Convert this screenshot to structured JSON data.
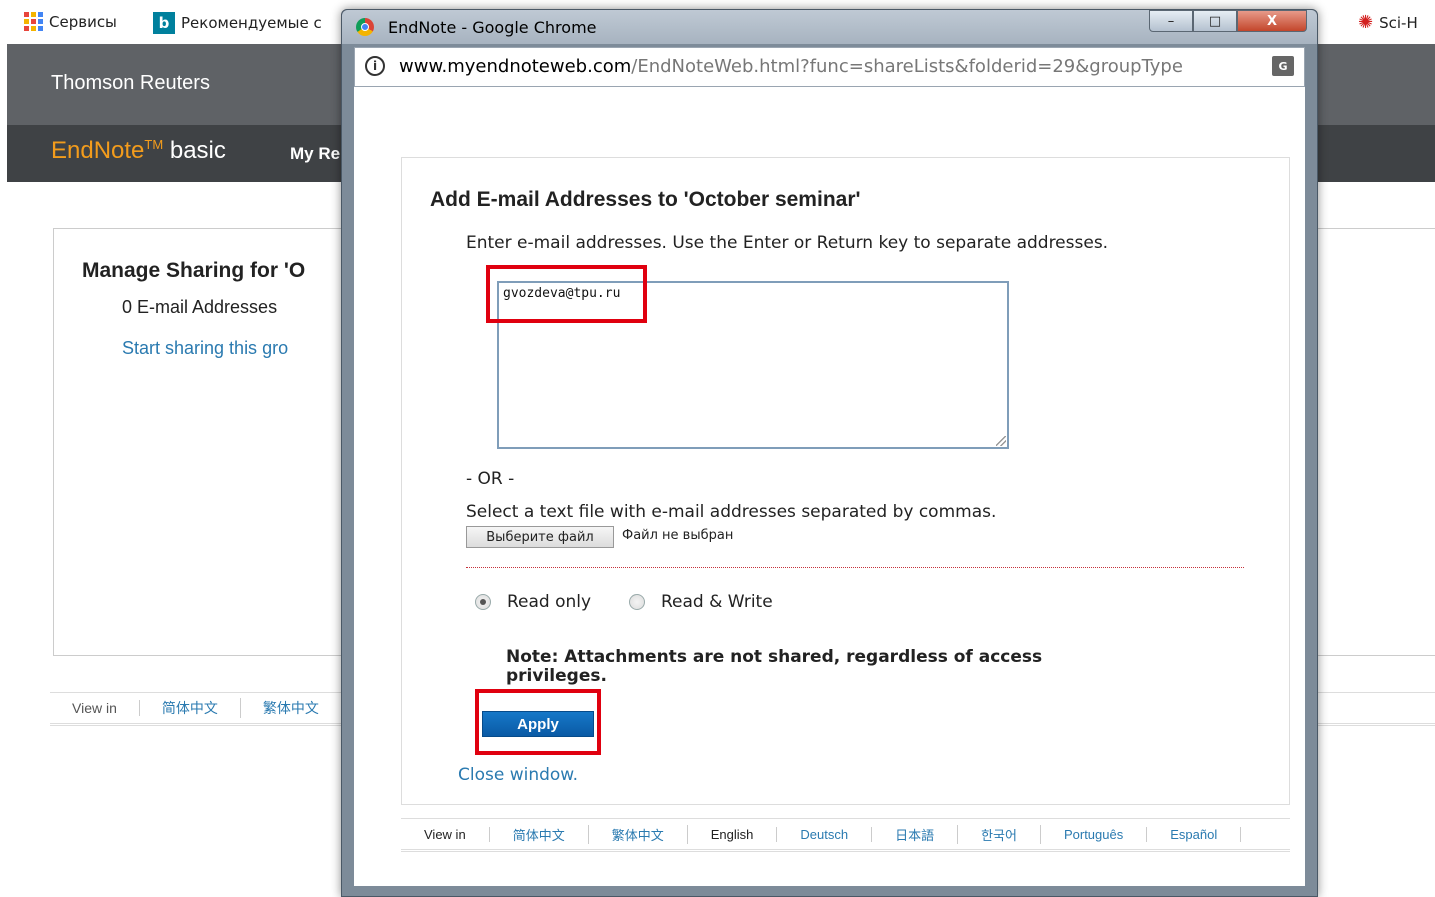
{
  "bookmarks": {
    "services": "Сервисы",
    "recommended": "Рекомендуемые с",
    "scihub": "Sci-H"
  },
  "bg": {
    "company": "Thomson Reuters",
    "brand_main": "EndNote",
    "brand_tm": "TM",
    "brand_sub": "basic",
    "nav_my": "My Re",
    "manage_title": "Manage Sharing for 'O",
    "email_count": "0 E-mail Addresses",
    "start_link": "Start sharing this gro",
    "footer": [
      "View in",
      "简体中文",
      "繁体中文"
    ]
  },
  "window": {
    "title": "EndNote - Google Chrome",
    "url_host": "www.myendnoteweb.com",
    "url_path": "/EndNoteWeb.html?func=shareLists&folderid=29&groupType",
    "min_icon": "–",
    "max_icon": "□",
    "close_icon": "X",
    "translate_icon": "G"
  },
  "dialog": {
    "title": "Add E-mail Addresses to 'October seminar'",
    "instructions": "Enter e-mail addresses. Use the Enter or Return key to separate addresses.",
    "email_value": "gvozdeva@tpu.ru",
    "or": "- OR -",
    "select_file_text": "Select a text file with e-mail addresses separated by commas.",
    "file_button": "Выберите файл",
    "file_status": "Файл не выбран",
    "radio_read_only": "Read only",
    "radio_read_write": "Read & Write",
    "note": "Note: Attachments are not shared, regardless of access privileges.",
    "apply": "Apply",
    "close": "Close window."
  },
  "footer_langs": [
    "View in",
    "简体中文",
    "繁体中文",
    "English",
    "Deutsch",
    "日本語",
    "한국어",
    "Português",
    "Español"
  ],
  "colors": {
    "accent_blue": "#0a5aa5",
    "link_blue": "#2a7ab0",
    "highlight_red": "#e0000f",
    "brand_orange": "#f39c1c"
  }
}
